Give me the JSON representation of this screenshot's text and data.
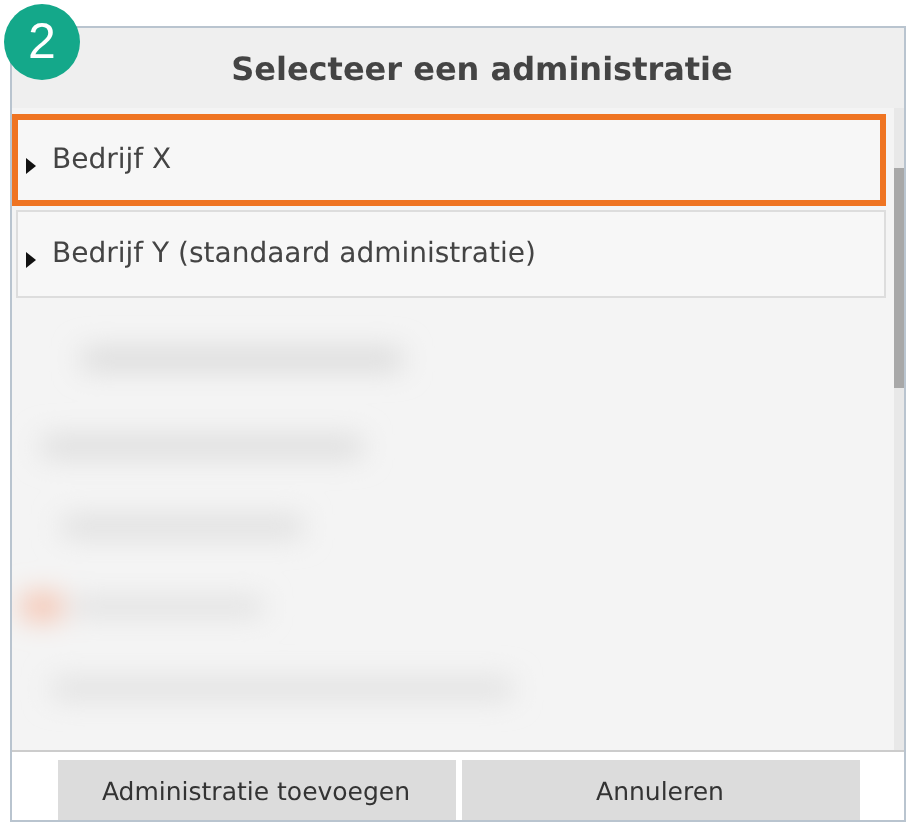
{
  "step_badge": "2",
  "dialog": {
    "title": "Selecteer een administratie",
    "items": [
      {
        "label": "Bedrijf X",
        "highlighted": true
      },
      {
        "label": "Bedrijf Y (standaard administratie)",
        "highlighted": false
      }
    ],
    "buttons": [
      "Administratie toevoegen",
      "Annuleren"
    ]
  }
}
